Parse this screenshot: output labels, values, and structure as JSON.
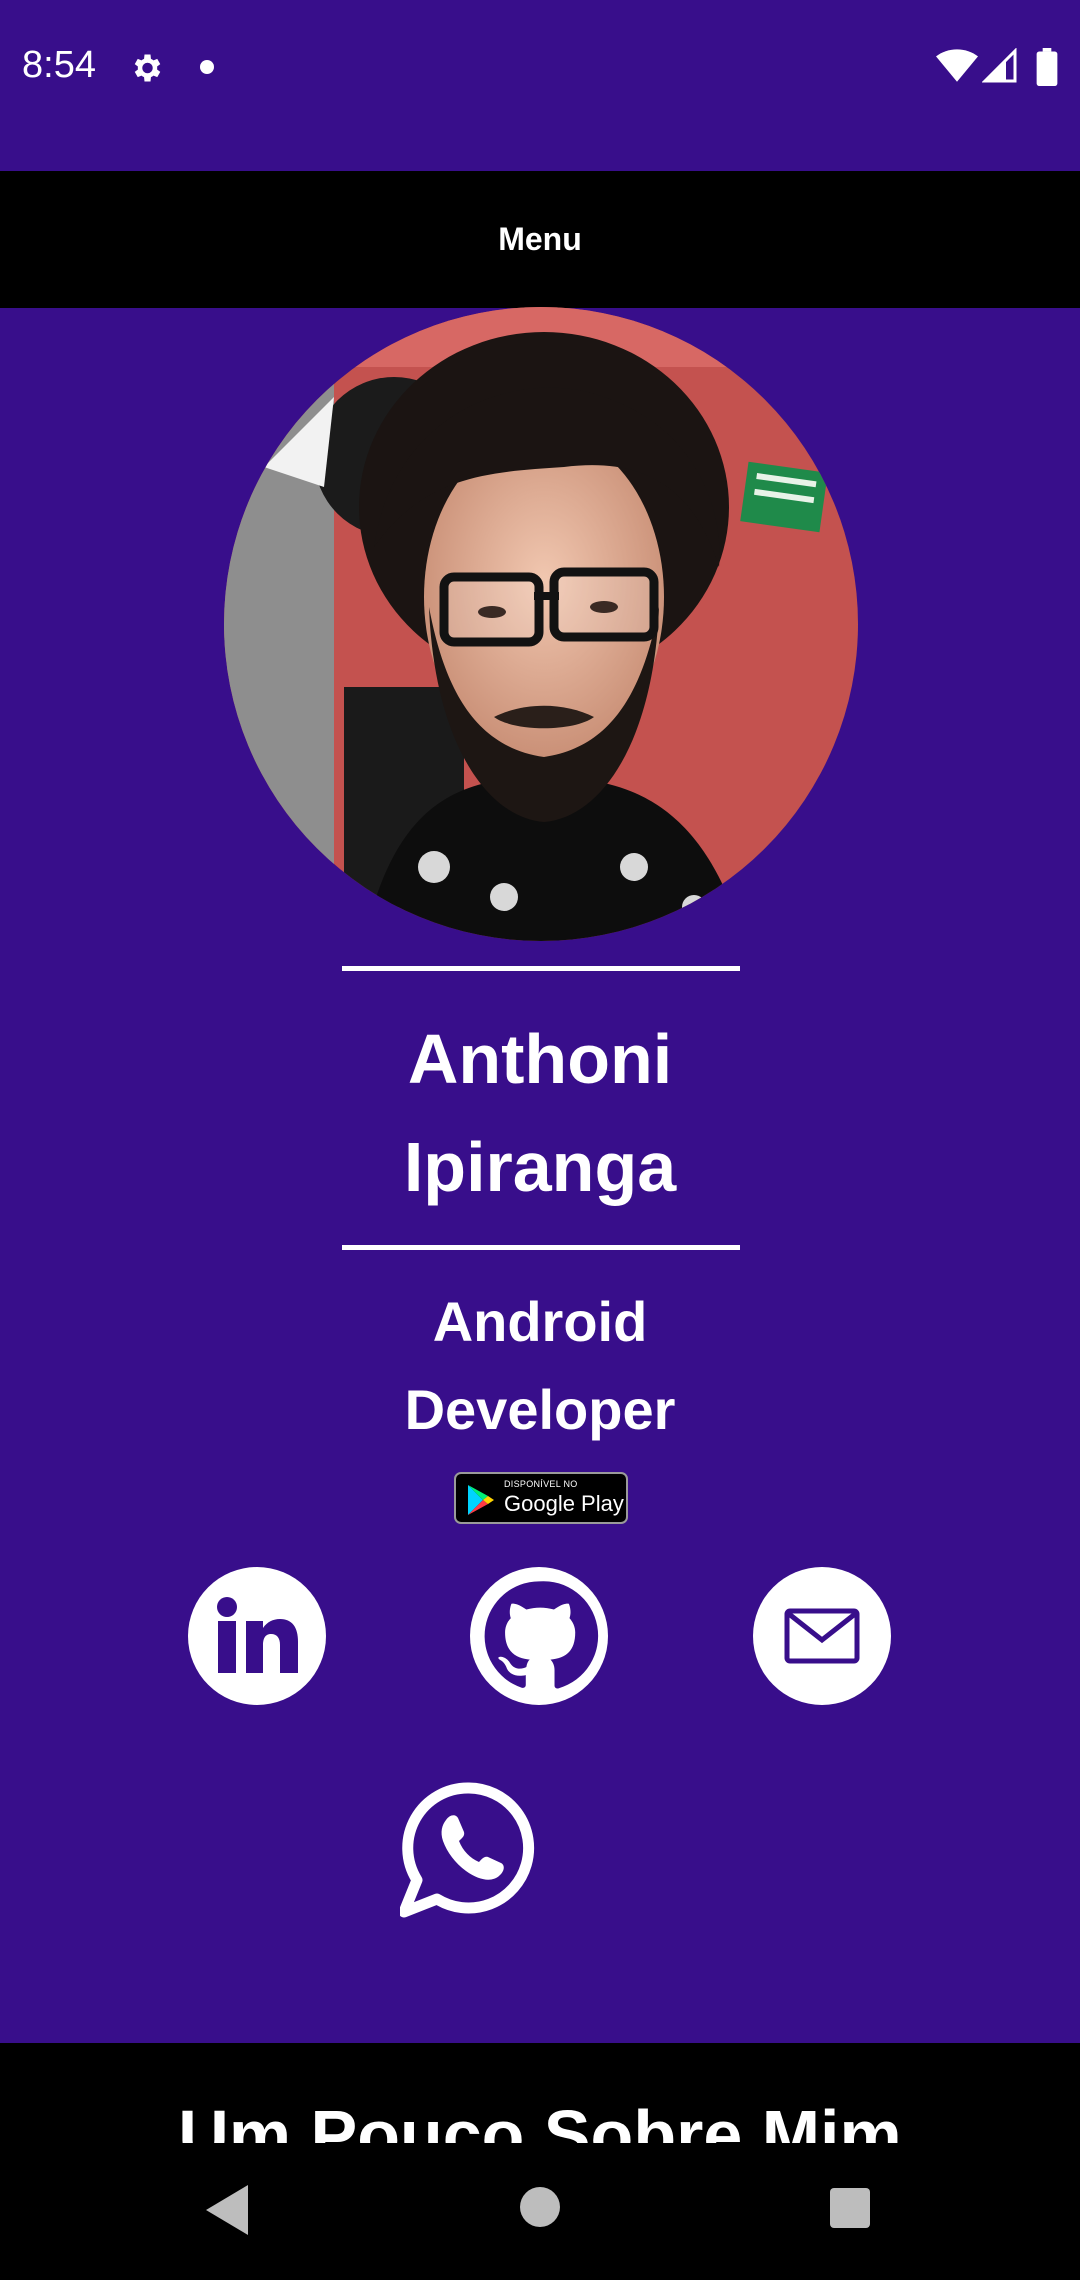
{
  "status_bar": {
    "time": "8:54",
    "icons": [
      "gear-icon",
      "notification-dot-icon",
      "wifi-icon",
      "signal-icon",
      "battery-icon"
    ]
  },
  "menu": {
    "label": "Menu"
  },
  "profile": {
    "name_line1": "Anthoni",
    "name_line2": "Ipiranga",
    "role_line1": "Android",
    "role_line2": "Developer"
  },
  "google_play_badge": {
    "top_text": "DISPONÍVEL NO",
    "main_text": "Google Play"
  },
  "social_links": [
    {
      "name": "linkedin",
      "icon": "linkedin-icon"
    },
    {
      "name": "github",
      "icon": "github-icon"
    },
    {
      "name": "email",
      "icon": "mail-icon"
    },
    {
      "name": "whatsapp",
      "icon": "whatsapp-icon"
    }
  ],
  "about": {
    "title": "Um Pouco Sobre Mim"
  },
  "nav_bar": {
    "icons": [
      "back-icon",
      "home-icon",
      "recents-icon"
    ]
  },
  "colors": {
    "background": "#380e8b",
    "bars": "#000000",
    "text": "#ffffff"
  }
}
